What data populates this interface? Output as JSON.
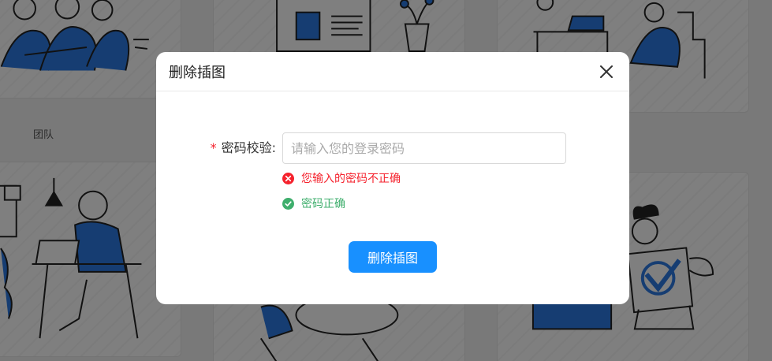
{
  "background": {
    "caption": "团队"
  },
  "dialog": {
    "title": "删除插图",
    "close_icon": "close-icon",
    "field": {
      "required_mark": "*",
      "label": "密码校验:",
      "placeholder": "请输入您的登录密码",
      "value": ""
    },
    "messages": {
      "error": {
        "icon": "error-circle-icon",
        "text": "您输入的密码不正确",
        "color": "#f5222d"
      },
      "success": {
        "icon": "check-circle-icon",
        "text": "密码正确",
        "color": "#3eae6c"
      }
    },
    "submit_label": "删除插图",
    "accent": "#1890ff"
  }
}
